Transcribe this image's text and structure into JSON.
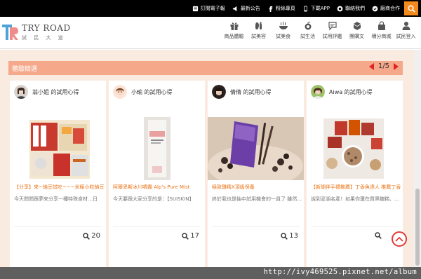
{
  "topbar": {
    "links": [
      {
        "label": "訂閱電子報",
        "icon": "newsletter-icon"
      },
      {
        "label": "最新公告",
        "icon": "announcement-icon"
      },
      {
        "label": "粉絲專頁",
        "icon": "facebook-icon"
      },
      {
        "label": "下載APP",
        "icon": "mobile-app-icon"
      },
      {
        "label": "聯絡我們",
        "icon": "contact-icon"
      },
      {
        "label": "廠商合作",
        "icon": "partnership-icon"
      }
    ],
    "search_icon": "search-icon",
    "accent": "#f28a1e"
  },
  "logo": {
    "text": "TRY ROAD",
    "subtext": "試 民 大 道"
  },
  "nav": [
    {
      "label": "商品體驗",
      "icon": "gift-icon"
    },
    {
      "label": "試美容",
      "icon": "beauty-icon"
    },
    {
      "label": "試美食",
      "icon": "food-icon"
    },
    {
      "label": "試生活",
      "icon": "life-icon"
    },
    {
      "label": "試用評鑑",
      "icon": "review-icon"
    },
    {
      "label": "團購文",
      "icon": "group-buy-icon"
    },
    {
      "label": "積分商城",
      "icon": "shop-icon"
    },
    {
      "label": "試民登入",
      "icon": "user-icon"
    }
  ],
  "section": {
    "title": "體驗精選",
    "page_indicator": "1/5",
    "header_color": "#f5a88a",
    "background": "#faebe1"
  },
  "cards": [
    {
      "user": "翁小姐 的試用心得",
      "title": "【分享】來~納豆試吃~~~米極小粒納豆",
      "excerpt": "今天問問跟夢來分享一種特殊食材…日",
      "views": "20"
    },
    {
      "user": "小瑜 的試用心得",
      "title": "阿爾卑斯冰川噴霧 Alp's Pure Mist",
      "excerpt": "今天要跟大家分享的是：【SUISKIN】",
      "views": "17"
    },
    {
      "user": "倩倩 的試用心得",
      "title": "極致雞精X頂級保養",
      "excerpt": "終於我也是抽中試用機會的一員了 雖然…",
      "views": "13"
    },
    {
      "user": "Aiwa 的試用心得",
      "title": "【新瑚伴手禮推薦】丁香魚達人 推薦丁香",
      "excerpt": "說到澎湖名產！如果你還在買黑糖糕、…",
      "views": ""
    }
  ],
  "watermark": "http://ivy469525.pixnet.net/album"
}
